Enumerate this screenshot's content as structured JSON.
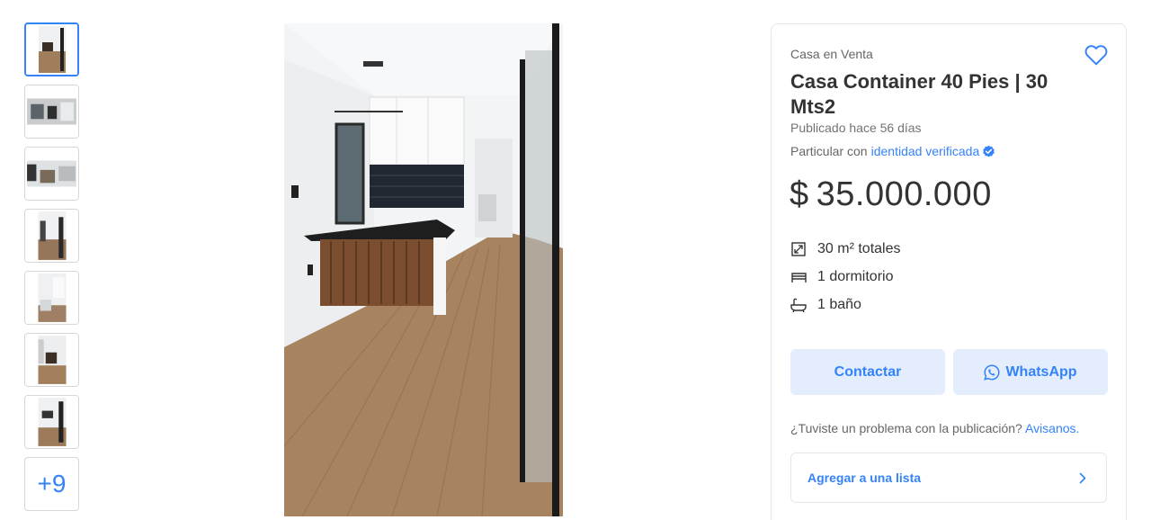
{
  "gallery": {
    "more_label": "+9",
    "thumbnails": [
      "thumb-1",
      "thumb-2",
      "thumb-3",
      "thumb-4",
      "thumb-5",
      "thumb-6",
      "thumb-7"
    ]
  },
  "listing": {
    "subtitle": "Casa en Venta",
    "title": "Casa Container 40 Pies | 30 Mts2",
    "published": "Publicado hace 56 días",
    "seller_prefix": "Particular con",
    "seller_link": "identidad verificada",
    "currency": "$",
    "price": "35.000.000"
  },
  "attributes": [
    {
      "icon": "area-icon",
      "label": "30 m² totales"
    },
    {
      "icon": "bed-icon",
      "label": "1 dormitorio"
    },
    {
      "icon": "bath-icon",
      "label": "1 baño"
    }
  ],
  "actions": {
    "contact_label": "Contactar",
    "whatsapp_label": "WhatsApp"
  },
  "report": {
    "question": "¿Tuviste un problema con la publicación?",
    "link": "Avisanos."
  },
  "add_list": {
    "label": "Agregar a una lista"
  },
  "colors": {
    "accent": "#3483fa",
    "button_bg": "#e3edfb"
  }
}
